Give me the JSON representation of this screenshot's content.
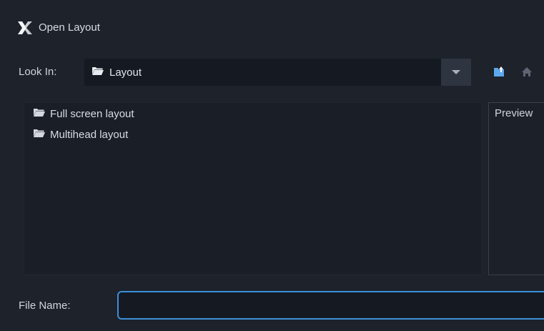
{
  "window": {
    "title": "Open Layout"
  },
  "look_in": {
    "label": "Look In:",
    "value": "Layout"
  },
  "toolbar": {
    "icons": [
      "up-folder-icon",
      "home-icon"
    ]
  },
  "files": [
    {
      "name": "Full screen layout",
      "icon": "folder-icon"
    },
    {
      "name": "Multihead layout",
      "icon": "folder-icon"
    }
  ],
  "preview": {
    "label": "Preview"
  },
  "file_name": {
    "label": "File Name:",
    "value": ""
  },
  "colors": {
    "accent": "#3d8fd8",
    "background": "#1d222b",
    "brand_x": "#ffffff"
  }
}
